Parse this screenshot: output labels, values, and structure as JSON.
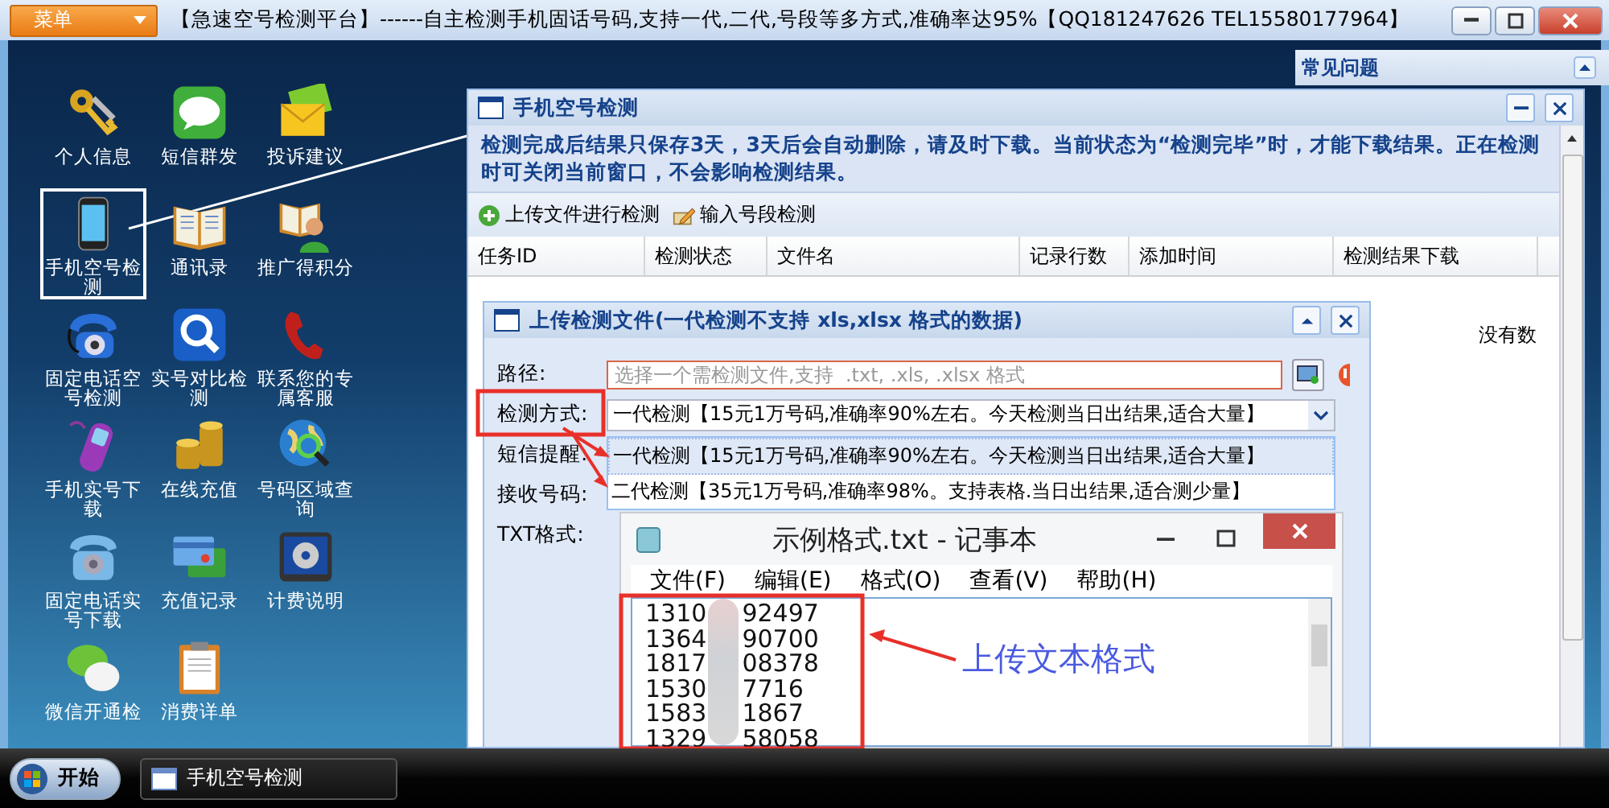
{
  "topbar": {
    "menu": "菜单",
    "title": "【急速空号检测平台】------自主检测手机固话号码,支持一代,二代,号段等多方式,准确率达95%【QQ181247626  TEL15580177964】"
  },
  "faq": {
    "title": "常见问题"
  },
  "desktop_icons": [
    {
      "label": "个人信息",
      "kind": "keys",
      "selected": false
    },
    {
      "label": "短信群发",
      "kind": "sms",
      "selected": false
    },
    {
      "label": "投诉建议",
      "kind": "envelope",
      "selected": false
    },
    {
      "label": "手机空号检测",
      "kind": "smartphone",
      "selected": true
    },
    {
      "label": "通讯录",
      "kind": "book",
      "selected": false
    },
    {
      "label": "推广得积分",
      "kind": "person-book",
      "selected": false
    },
    {
      "label": "固定电话空号检测",
      "kind": "rotary",
      "selected": false
    },
    {
      "label": "实号对比检测",
      "kind": "search",
      "selected": false
    },
    {
      "label": "联系您的专属客服",
      "kind": "handset",
      "selected": false
    },
    {
      "label": "手机实号下载",
      "kind": "cellphone",
      "selected": false
    },
    {
      "label": "在线充值",
      "kind": "coins",
      "selected": false
    },
    {
      "label": "号码区域查询",
      "kind": "globe",
      "selected": false
    },
    {
      "label": "固定电话实号下载",
      "kind": "deskphone",
      "selected": false
    },
    {
      "label": "充值记录",
      "kind": "card",
      "selected": false
    },
    {
      "label": "计费说明",
      "kind": "gear",
      "selected": false
    },
    {
      "label": "微信开通检",
      "kind": "chat",
      "selected": false
    },
    {
      "label": "消费详单",
      "kind": "clipboard",
      "selected": false
    }
  ],
  "main_window": {
    "title": "手机空号检测",
    "notice": "检测完成后结果只保存3天，3天后会自动删除，请及时下载。当前状态为“检测完毕”时，才能下载结果。正在检测时可关闭当前窗口，不会影响检测结果。",
    "toolbar": [
      {
        "label": "上传文件进行检测",
        "kind": "add"
      },
      {
        "label": "输入号段检测",
        "kind": "edit"
      }
    ],
    "columns": [
      "任务ID",
      "检测状态",
      "文件名",
      "记录行数",
      "添加时间",
      "检测结果下载"
    ],
    "empty_text": "没有数"
  },
  "upload_dialog": {
    "title": "上传检测文件(一代检测不支持  xls,xlsx 格式的数据)",
    "path_label": "路径:",
    "path_placeholder": "选择一个需检测文件,支持  .txt, .xls, .xlsx 格式",
    "method_label": "检测方式:",
    "method_value": "一代检测【15元1万号码,准确率90%左右。今天检测当日出结果,适合大量】",
    "options": [
      {
        "label": "一代检测【15元1万号码,准确率90%左右。今天检测当日出结果,适合大量】",
        "selected": true
      },
      {
        "label": "二代检测【35元1万号码,准确率98%。支持表格.当日出结果,适合测少量】",
        "selected": false
      }
    ],
    "sms_label": "短信提醒:",
    "receive_label": "接收号码:",
    "txt_label": "TXT格式:"
  },
  "notepad": {
    "title": "示例格式.txt - 记事本",
    "menu": [
      "文件(F)",
      "编辑(E)",
      "格式(O)",
      "查看(V)",
      "帮助(H)"
    ],
    "lines": [
      {
        "head": "1310",
        "tail": "92497"
      },
      {
        "head": "1364",
        "tail": "90700"
      },
      {
        "head": "1817",
        "tail": "08378"
      },
      {
        "head": "1530",
        "tail": "7716"
      },
      {
        "head": "1583",
        "tail": "1867"
      },
      {
        "head": "1329",
        "tail": "58058"
      }
    ]
  },
  "annotation": {
    "label": "上传文本格式"
  },
  "taskbar": {
    "start": "开始",
    "tasks": [
      {
        "label": "手机空号检测",
        "selected": false
      }
    ]
  }
}
